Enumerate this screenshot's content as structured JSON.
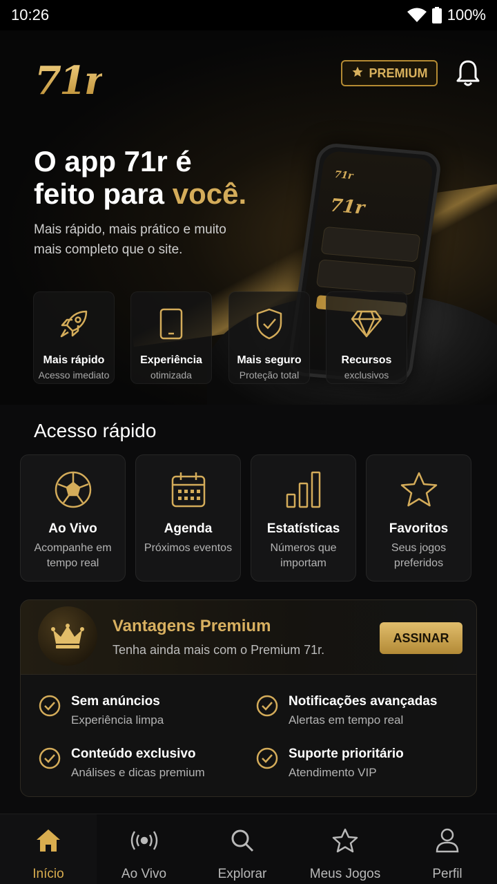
{
  "status_bar": {
    "time": "10:26",
    "battery": "100%"
  },
  "header": {
    "logo": "71r",
    "premium_label": "PREMIUM"
  },
  "hero": {
    "title_line1": "O app 71r é",
    "title_line2_prefix": "feito para ",
    "title_line2_highlight": "você.",
    "subtitle": "Mais rápido, mais prático e muito mais completo que o site.",
    "phone_logo": "71r"
  },
  "features": [
    {
      "icon": "rocket-icon",
      "title": "Mais rápido",
      "subtitle": "Acesso imediato"
    },
    {
      "icon": "smartphone-icon",
      "title": "Experiência",
      "subtitle": "otimizada"
    },
    {
      "icon": "shield-icon",
      "title": "Mais seguro",
      "subtitle": "Proteção total"
    },
    {
      "icon": "diamond-icon",
      "title": "Recursos",
      "subtitle": "exclusivos"
    }
  ],
  "quick_access": {
    "title": "Acesso rápido",
    "items": [
      {
        "icon": "soccer-ball-icon",
        "title": "Ao Vivo",
        "subtitle": "Acompanhe em tempo real"
      },
      {
        "icon": "calendar-icon",
        "title": "Agenda",
        "subtitle": "Próximos eventos"
      },
      {
        "icon": "bar-chart-icon",
        "title": "Estatísticas",
        "subtitle": "Números que importam"
      },
      {
        "icon": "star-icon",
        "title": "Favoritos",
        "subtitle": "Seus jogos preferidos"
      }
    ]
  },
  "premium": {
    "title": "Vantagens Premium",
    "subtitle": "Tenha ainda mais com o Premium 71r.",
    "cta": "ASSINAR",
    "benefits": [
      {
        "title": "Sem anúncios",
        "subtitle": "Experiência limpa"
      },
      {
        "title": "Notificações avançadas",
        "subtitle": "Alertas em tempo real"
      },
      {
        "title": "Conteúdo exclusivo",
        "subtitle": "Análises e dicas premium"
      },
      {
        "title": "Suporte prioritário",
        "subtitle": "Atendimento VIP"
      }
    ]
  },
  "bottom_nav": [
    {
      "icon": "home-icon",
      "label": "Início",
      "active": true
    },
    {
      "icon": "broadcast-icon",
      "label": "Ao Vivo",
      "active": false
    },
    {
      "icon": "search-icon",
      "label": "Explorar",
      "active": false
    },
    {
      "icon": "star-outline-icon",
      "label": "Meus Jogos",
      "active": false
    },
    {
      "icon": "user-icon",
      "label": "Perfil",
      "active": false
    }
  ],
  "colors": {
    "gold": "#d4ac5a",
    "background": "#0b0b0c",
    "active_nav": "#d9ad4f"
  }
}
